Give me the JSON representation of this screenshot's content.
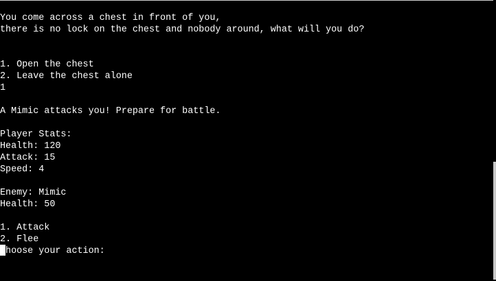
{
  "terminal": {
    "lines": [
      "You come across a chest in front of you,",
      "there is no lock on the chest and nobody around, what will you do?",
      "",
      "",
      "1. Open the chest",
      "2. Leave the chest alone",
      "1",
      "",
      "A Mimic attacks you! Prepare for battle.",
      "",
      "Player Stats:",
      "Health: 120",
      "Attack: 15",
      "Speed: 4",
      "",
      "Enemy: Mimic",
      "Health: 50",
      "",
      "1. Attack",
      "2. Flee",
      "Choose your action:"
    ]
  },
  "colors": {
    "background": "#000000",
    "text": "#ffffff",
    "cursor": "#ffffff",
    "scrollbar_thumb": "#c8c8c8"
  }
}
